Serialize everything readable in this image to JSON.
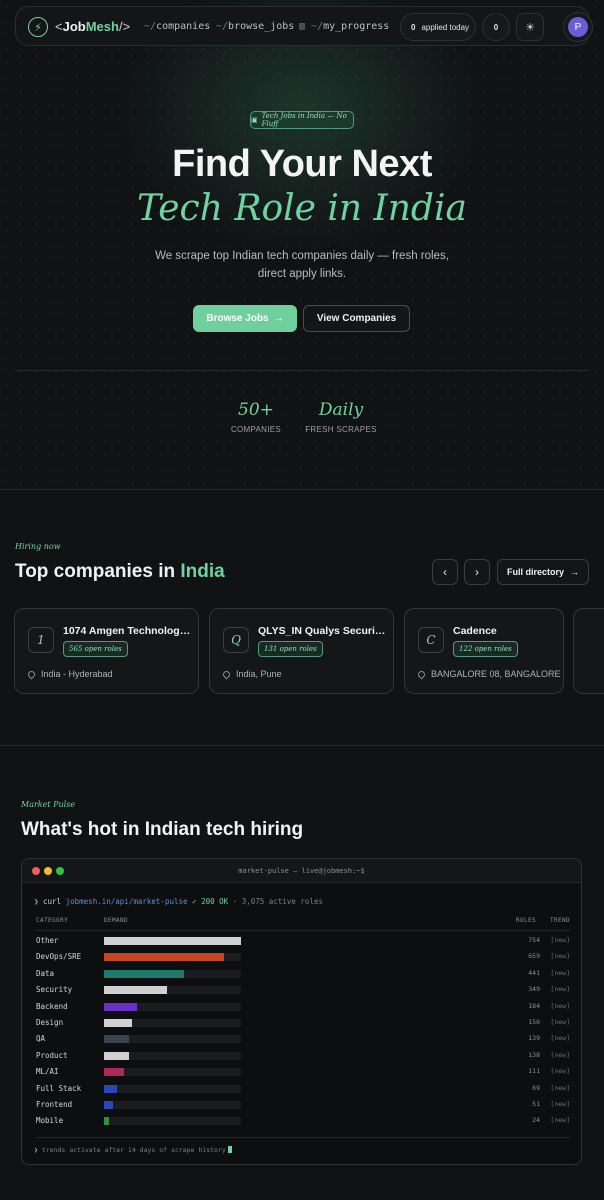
{
  "nav": {
    "logo_prefix": "<",
    "logo_job": "Job",
    "logo_mesh": "Mesh",
    "logo_suffix": "/>",
    "links": [
      {
        "prefix": "~/",
        "label": "companies"
      },
      {
        "prefix": "~/",
        "label": "browse_jobs"
      },
      {
        "prefix": "~/",
        "label": "my_progress"
      }
    ],
    "applied_count": "0",
    "applied_label": "applied today",
    "second_count": "0",
    "avatar_initial": "P"
  },
  "hero": {
    "tag": "Tech Jobs in India — No Fluff",
    "title_line1": "Find Your Next",
    "title_line2": "Tech Role in India",
    "subtitle": "We scrape top Indian tech companies daily — fresh roles, direct apply links.",
    "primary_button": "Browse Jobs",
    "secondary_button": "View Companies",
    "stats": [
      {
        "value": "50+",
        "label": "COMPANIES"
      },
      {
        "value": "Daily",
        "label": "FRESH SCRAPES"
      }
    ]
  },
  "companies": {
    "section_label": "Hiring now",
    "title_prefix": "Top companies in ",
    "title_highlight": "India",
    "directory_button": "Full directory",
    "cards": [
      {
        "initial": "1",
        "name": "1074 Amgen Technology ...",
        "roles": "565 open roles",
        "location": "India - Hyderabad"
      },
      {
        "initial": "Q",
        "name": "QLYS_IN Qualys Security ...",
        "roles": "131 open roles",
        "location": "India, Pune"
      },
      {
        "initial": "C",
        "name": "Cadence",
        "roles": "122 open roles",
        "location": "BANGALORE 08, BANGALORE"
      }
    ]
  },
  "market": {
    "section_label": "Market Pulse",
    "title": "What's hot in Indian tech hiring",
    "terminal_title": "market-pulse — live@jobmesh:~$",
    "command_prompt": "❯",
    "command": "curl",
    "url": "jobmesh.in/api/market-pulse",
    "status": "✓ 200 OK",
    "summary": "· 3,075 active roles",
    "headers": {
      "category": "CATEGORY",
      "demand": "DEMAND",
      "roles": "ROLES",
      "trend": "TREND"
    },
    "rows": [
      {
        "category": "Other",
        "roles": 754,
        "trend": "[new]",
        "color": "#d0d0d0"
      },
      {
        "category": "DevOps/SRE",
        "roles": 659,
        "trend": "[new]",
        "color": "#c5461f"
      },
      {
        "category": "Data",
        "roles": 441,
        "trend": "[new]",
        "color": "#1f7a6c"
      },
      {
        "category": "Security",
        "roles": 349,
        "trend": "[new]",
        "color": "#d0d0d0"
      },
      {
        "category": "Backend",
        "roles": 184,
        "trend": "[new]",
        "color": "#6a2fc4"
      },
      {
        "category": "Design",
        "roles": 156,
        "trend": "[new]",
        "color": "#d0d0d0"
      },
      {
        "category": "QA",
        "roles": 139,
        "trend": "[new]",
        "color": "#3b4250"
      },
      {
        "category": "Product",
        "roles": 138,
        "trend": "[new]",
        "color": "#d0d0d0"
      },
      {
        "category": "ML/AI",
        "roles": 111,
        "trend": "[new]",
        "color": "#b0275a"
      },
      {
        "category": "Full Stack",
        "roles": 69,
        "trend": "[new]",
        "color": "#2a47b8"
      },
      {
        "category": "Frontend",
        "roles": 51,
        "trend": "[new]",
        "color": "#2a47b8"
      },
      {
        "category": "Mobile",
        "roles": 24,
        "trend": "[new]",
        "color": "#2f8f3a"
      }
    ],
    "footer_prompt": "❯",
    "footer": "trends activate after 14 days of scrape history"
  }
}
